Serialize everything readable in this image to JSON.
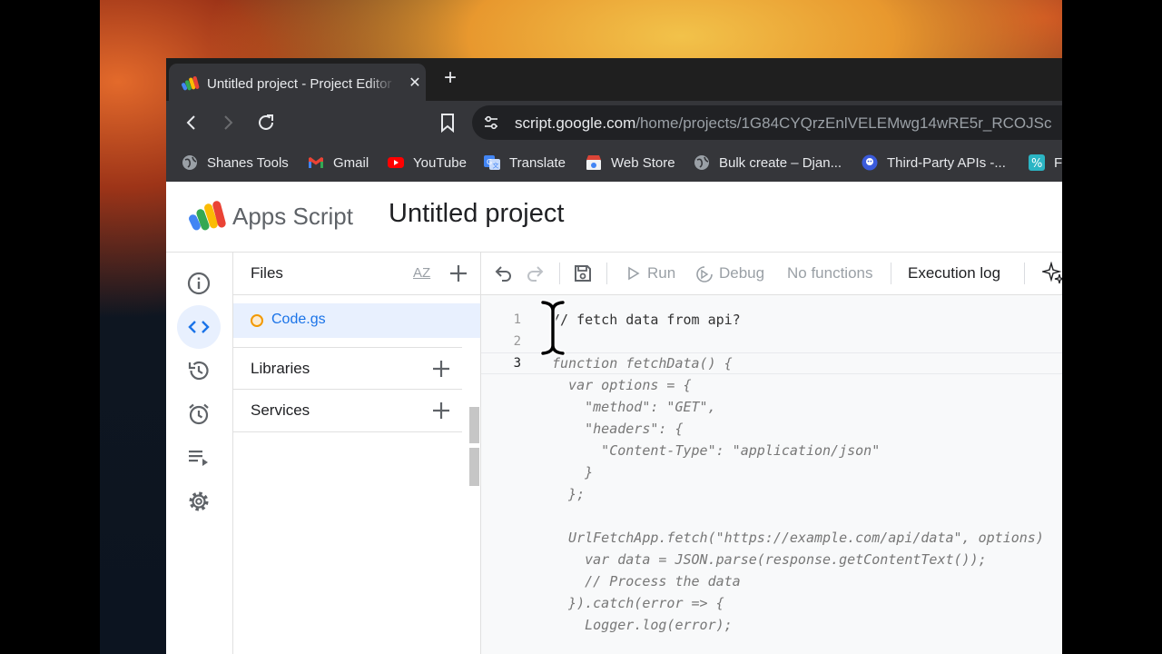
{
  "browser": {
    "tab_title": "Untitled project - Project Editor - Apps Script",
    "new_tab_symbol": "+",
    "close_symbol": "✕",
    "url_host": "script.google.com",
    "url_path": "/home/projects/1G84CYQrzEnlVELEMwg14wRE5r_RCOJSc",
    "bookmarks": [
      {
        "label": "Shanes Tools",
        "icon": "globe-icon"
      },
      {
        "label": "Gmail",
        "icon": "gmail-icon"
      },
      {
        "label": "YouTube",
        "icon": "youtube-icon"
      },
      {
        "label": "Translate",
        "icon": "translate-icon"
      },
      {
        "label": "Web Store",
        "icon": "web-store-icon"
      },
      {
        "label": "Bulk create – Djan...",
        "icon": "globe-icon"
      },
      {
        "label": "Third-Party APIs -...",
        "icon": "api-icon"
      },
      {
        "label": "F",
        "icon": "percent-icon"
      }
    ]
  },
  "app": {
    "logo_text": "Apps Script",
    "project_title": "Untitled project"
  },
  "rail": {
    "items": [
      {
        "name": "overview",
        "icon": "info-icon"
      },
      {
        "name": "editor",
        "icon": "code-icon",
        "active": true
      },
      {
        "name": "triggers-history",
        "icon": "history-icon"
      },
      {
        "name": "triggers",
        "icon": "alarm-icon"
      },
      {
        "name": "executions",
        "icon": "executions-icon"
      },
      {
        "name": "settings",
        "icon": "gear-icon"
      }
    ]
  },
  "files_panel": {
    "title": "Files",
    "sort_label": "AZ",
    "files": [
      {
        "name": "Code.gs"
      }
    ],
    "libraries_label": "Libraries",
    "services_label": "Services"
  },
  "editor_toolbar": {
    "run_label": "Run",
    "debug_label": "Debug",
    "function_select": "No functions",
    "execution_log_label": "Execution log"
  },
  "code": {
    "line_numbers": [
      "1",
      "2",
      "3"
    ],
    "lines": [
      "// fetch data from api?",
      "",
      "function fetchData() {",
      "  var options = {",
      "    \"method\": \"GET\",",
      "    \"headers\": {",
      "      \"Content-Type\": \"application/json\"",
      "    }",
      "  };",
      "",
      "  UrlFetchApp.fetch(\"https://example.com/api/data\", options)",
      "    var data = JSON.parse(response.getContentText());",
      "    // Process the data",
      "  }).catch(error => {",
      "    Logger.log(error);"
    ]
  },
  "colors": {
    "chrome_dark": "#35363a",
    "accent_blue": "#1a73e8",
    "selected_bg": "#e8f0fe"
  }
}
